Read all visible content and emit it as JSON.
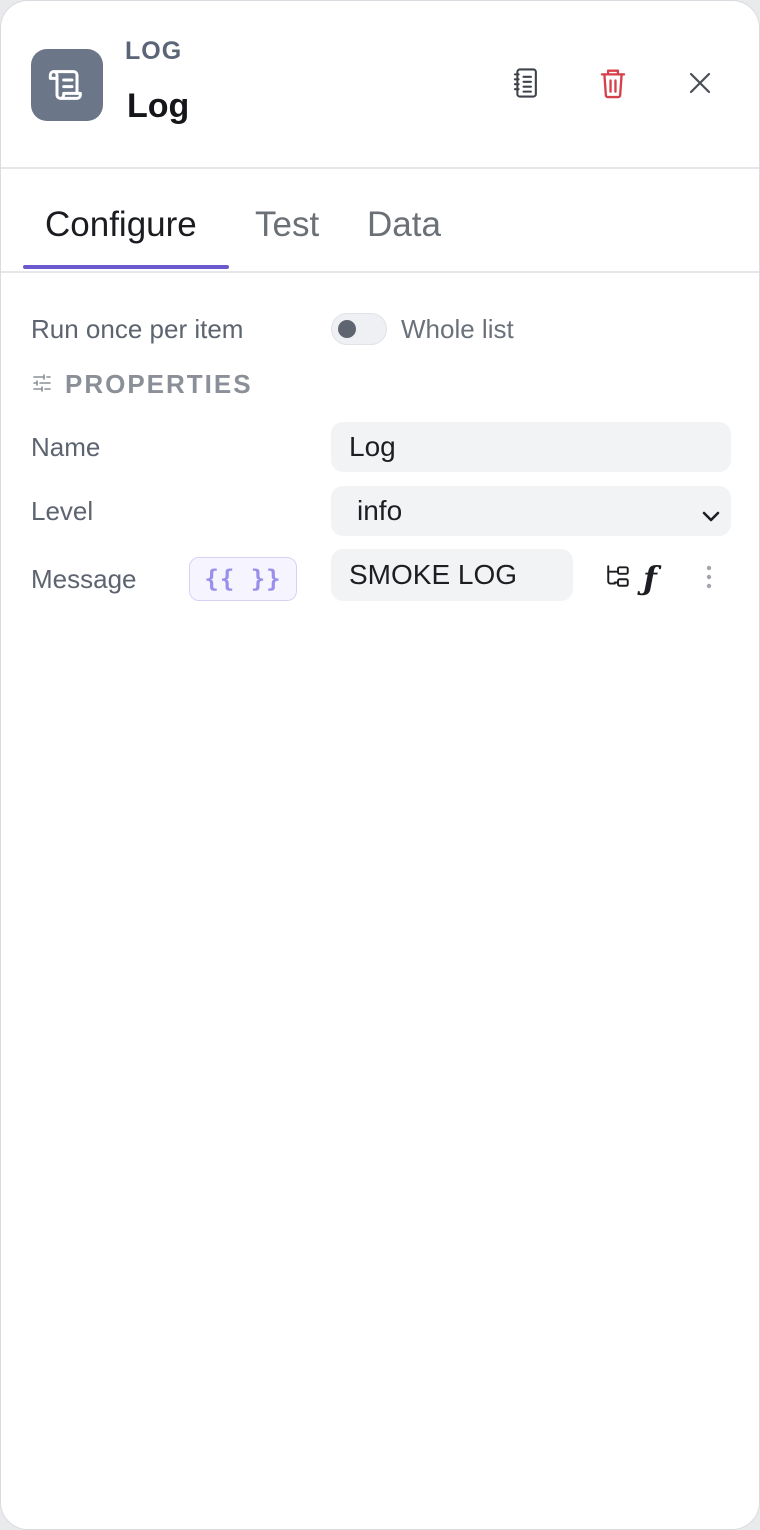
{
  "node": {
    "type_label": "LOG",
    "name": "Log"
  },
  "header_actions": {
    "docs_icon": "notebook-icon",
    "delete_icon": "trash-icon",
    "close_icon": "close-icon"
  },
  "tabs": [
    {
      "label": "Configure",
      "active": true
    },
    {
      "label": "Test",
      "active": false
    },
    {
      "label": "Data",
      "active": false
    }
  ],
  "run_mode": {
    "left_label": "Run once per item",
    "right_label": "Whole list",
    "whole_list_enabled": false
  },
  "properties": {
    "section_title": "PROPERTIES",
    "name": {
      "label": "Name",
      "value": "Log"
    },
    "level": {
      "label": "Level",
      "value": "info"
    },
    "message": {
      "label": "Message",
      "expr_badge": "{{ }}",
      "value": "SMOKE LOG",
      "fx_label": "ƒ"
    }
  },
  "colors": {
    "accent": "#6a5acd",
    "delete": "#d6404a",
    "node_icon_bg": "#6b7689"
  }
}
